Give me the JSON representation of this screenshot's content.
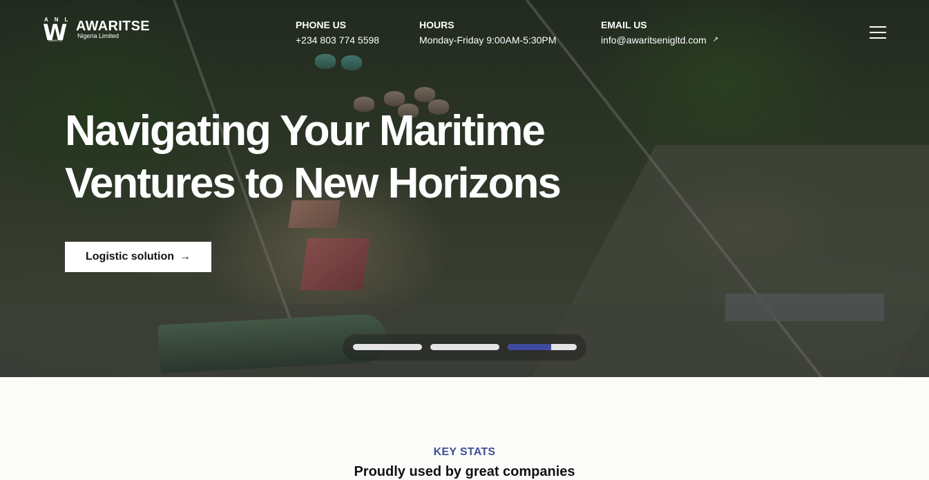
{
  "brand": {
    "mark_letters": "ANL",
    "mark": "W",
    "mark_sub": "AWARITSE",
    "name": "AWARITSE",
    "tagline": "Nigeria Limited"
  },
  "header": {
    "phone": {
      "label": "PHONE US",
      "value": "+234 803 774 5598"
    },
    "hours": {
      "label": "HOURS",
      "value": "Monday-Friday 9:00AM-5:30PM"
    },
    "email": {
      "label": "EMAIL US",
      "value": "info@awaritsenigltd.com",
      "icon": "arrow-up-right-icon"
    },
    "menu_icon": "hamburger-menu-icon"
  },
  "hero": {
    "headline_line1": "Navigating Your Maritime",
    "headline_line2": "Ventures to New Horizons",
    "cta_label": "Logistic solution",
    "cta_icon": "arrow-right-icon",
    "slides": {
      "count": 3,
      "active_index": 2,
      "active_progress": 0.63
    }
  },
  "stats": {
    "eyebrow": "KEY STATS",
    "title": "Proudly used by great companies"
  },
  "colors": {
    "accent": "#3f4aa0",
    "eyebrow": "#3f4f95",
    "page_bg": "#fcfcfa"
  }
}
